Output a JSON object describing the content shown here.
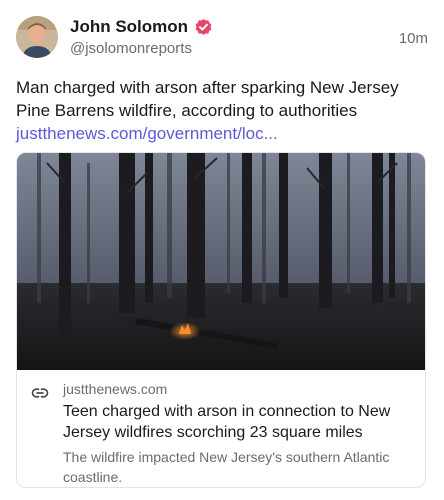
{
  "post": {
    "author_name": "John Solomon",
    "handle": "@jsolomonreports",
    "time": "10m",
    "text_line_1": "Man charged with arson after sparking New Jersey",
    "text_line_2": "Pine Barrens wildfire, according to authorities",
    "link_text": "justthenews.com/government/loc...",
    "verified_color": "#e8456b",
    "link_color": "#5b5bd6"
  },
  "card": {
    "domain": "justthenews.com",
    "title": "Teen charged with arson in connection to New Jersey wildfires scorching 23 square miles",
    "description": "The wildfire impacted New Jersey's southern Atlantic coastline.",
    "image_description_icon": "burned-forest-image",
    "icon": "link-icon"
  }
}
